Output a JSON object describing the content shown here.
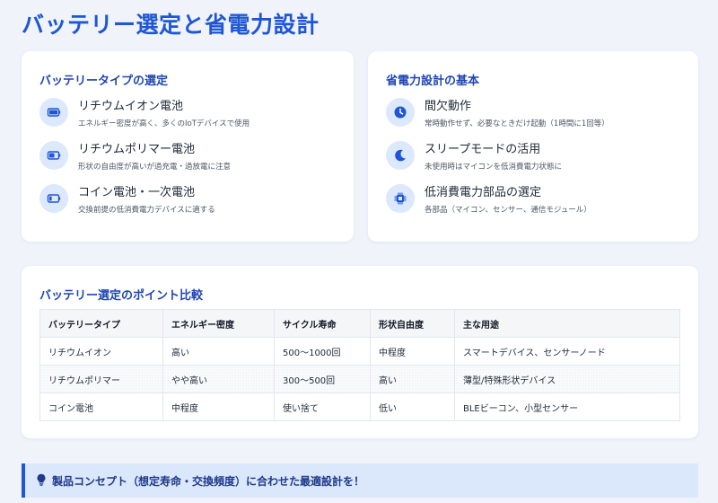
{
  "page": {
    "title": "バッテリー選定と省電力設計"
  },
  "battery_types": {
    "heading": "バッテリータイプの選定",
    "items": [
      {
        "icon": "battery-full-icon",
        "title": "リチウムイオン電池",
        "desc": "エネルギー密度が高く、多くのIoTデバイスで使用"
      },
      {
        "icon": "battery-half-icon",
        "title": "リチウムポリマー電池",
        "desc": "形状の自由度が高いが過充電・過放電に注意"
      },
      {
        "icon": "battery-low-icon",
        "title": "コイン電池・一次電池",
        "desc": "交換前提の低消費電力デバイスに適する"
      }
    ]
  },
  "power_design": {
    "heading": "省電力設計の基本",
    "items": [
      {
        "icon": "clock-icon",
        "title": "間欠動作",
        "desc": "常時動作せず、必要なときだけ起動（1時間に1回等）"
      },
      {
        "icon": "moon-icon",
        "title": "スリープモードの活用",
        "desc": "未使用時はマイコンを低消費電力状態に"
      },
      {
        "icon": "chip-icon",
        "title": "低消費電力部品の選定",
        "desc": "各部品（マイコン、センサー、通信モジュール）"
      }
    ]
  },
  "comparison": {
    "heading": "バッテリー選定のポイント比較",
    "columns": [
      "バッテリータイプ",
      "エネルギー密度",
      "サイクル寿命",
      "形状自由度",
      "主な用途"
    ],
    "rows": [
      [
        "リチウムイオン",
        "高い",
        "500〜1000回",
        "中程度",
        "スマートデバイス、センサーノード"
      ],
      [
        "リチウムポリマー",
        "やや高い",
        "300〜500回",
        "高い",
        "薄型/特殊形状デバイス"
      ],
      [
        "コイン電池",
        "中程度",
        "使い捨て",
        "低い",
        "BLEビーコン、小型センサー"
      ]
    ]
  },
  "callout": {
    "icon": "lightbulb-icon",
    "text": "製品コンセプト（想定寿命・交換頻度）に合わせた最適設計を！"
  },
  "colors": {
    "accent": "#1e56d6",
    "heading": "#1e45b4",
    "icon_bg": "#dce8fb",
    "callout_bg": "#dbe7fb"
  }
}
